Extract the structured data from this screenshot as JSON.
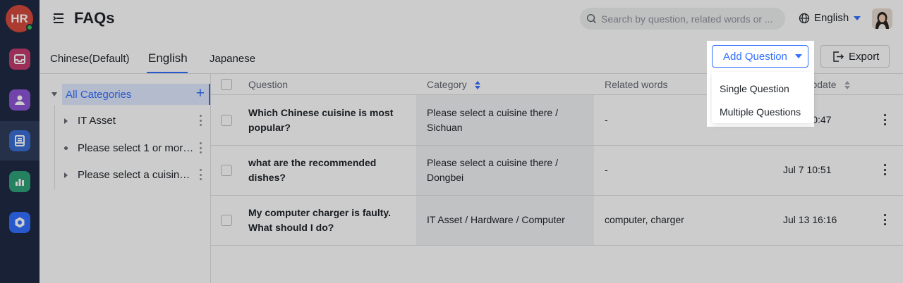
{
  "rail": {
    "avatar_initials": "HR",
    "items": [
      {
        "name": "inbox",
        "color": "#c23b6e"
      },
      {
        "name": "people",
        "color": "#8e55d6"
      },
      {
        "name": "knowledge",
        "color": "#3b6fd6",
        "active": true
      },
      {
        "name": "analytics",
        "color": "#2fa37a"
      },
      {
        "name": "settings",
        "color": "#3370ff"
      }
    ]
  },
  "header": {
    "title": "FAQs",
    "search_placeholder": "Search by question, related words or ...",
    "language": "English"
  },
  "tabs": [
    {
      "label": "Chinese(Default)"
    },
    {
      "label": "English",
      "active": true
    },
    {
      "label": "Japanese"
    }
  ],
  "toolbar": {
    "add_label": "Add Question",
    "export_label": "Export"
  },
  "dropdown": {
    "items": [
      "Single Question",
      "Multiple Questions"
    ]
  },
  "tree": {
    "root": "All Categories",
    "items": [
      {
        "label": "IT Asset",
        "type": "expandable"
      },
      {
        "label": "Please select 1 or more ...",
        "type": "leaf"
      },
      {
        "label": "Please select a cuisine t...",
        "type": "expandable"
      }
    ]
  },
  "table": {
    "columns": {
      "question": "Question",
      "category": "Category",
      "related": "Related words",
      "update": "Last Update"
    },
    "rows": [
      {
        "question": "Which Chinese cuisine is most popular?",
        "category": "Please select a cuisine there / Sichuan",
        "related": "-",
        "update": "Jul 7 10:47"
      },
      {
        "question": "what are the recommended dishes?",
        "category": "Please select a cuisine there / Dongbei",
        "related": "-",
        "update": "Jul 7 10:51"
      },
      {
        "question": "My computer charger is faulty. What should I do?",
        "category": "IT Asset / Hardware / Computer",
        "related": "computer, charger",
        "update": "Jul 13 16:16"
      }
    ]
  },
  "colors": {
    "accent": "#3370ff",
    "rail_bg": "#1f2a44"
  }
}
